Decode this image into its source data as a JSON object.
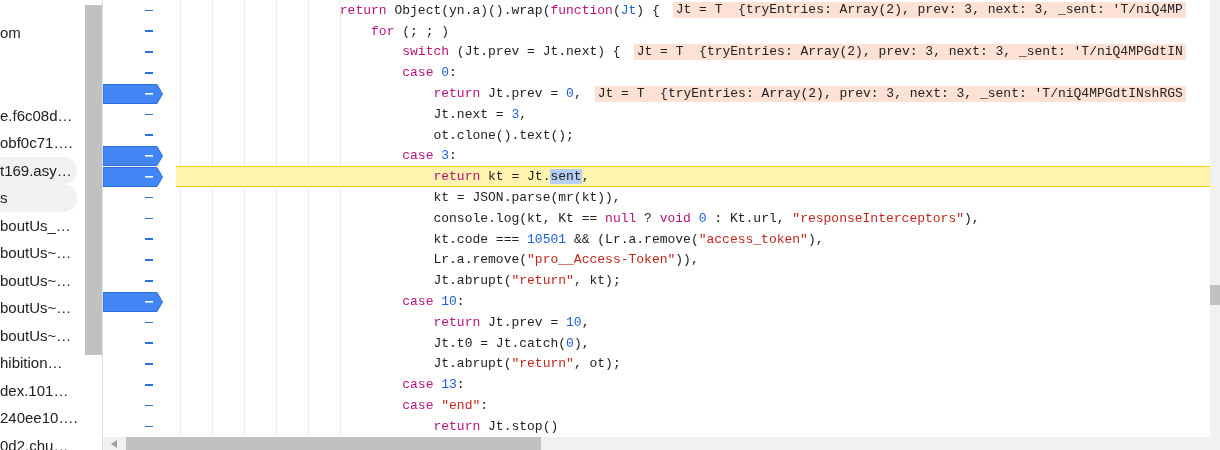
{
  "sidebar": {
    "items": [
      {
        "label": "om",
        "selected": false
      },
      {
        "label": "e.f6c08d…",
        "selected": false
      },
      {
        "label": "obf0c71….",
        "selected": false
      },
      {
        "label": "t169.asy…",
        "selected": true
      },
      {
        "label": "s",
        "selected": true
      },
      {
        "label": "boutUs_…",
        "selected": false
      },
      {
        "label": "boutUs~…",
        "selected": false
      },
      {
        "label": "boutUs~…",
        "selected": false
      },
      {
        "label": "boutUs~…",
        "selected": false
      },
      {
        "label": "boutUs~…",
        "selected": false
      },
      {
        "label": "hibition…",
        "selected": false
      },
      {
        "label": "dex.101…",
        "selected": false
      },
      {
        "label": "240ee10….",
        "selected": false
      },
      {
        "label": "0d2.chu…",
        "selected": false
      }
    ]
  },
  "code": [
    {
      "breakpoint": false,
      "current": false,
      "tokens": [
        {
          "text": "return ",
          "kind": "keyword"
        },
        {
          "text": "Object(yn.a)().wrap(",
          "kind": "plain"
        },
        {
          "text": "function",
          "kind": "keyword"
        },
        {
          "text": "(",
          "kind": "plain"
        },
        {
          "text": "Jt",
          "kind": "param"
        },
        {
          "text": ") {",
          "kind": "plain"
        }
      ],
      "inline_value": "Jt = T  {tryEntries: Array(2), prev: 3, next: 3, _sent: 'T/niQ4MP",
      "children": [
        {
          "breakpoint": false,
          "current": false,
          "tokens": [
            {
              "text": "for",
              "kind": "keyword"
            },
            {
              "text": " (; ; )",
              "kind": "plain"
            }
          ],
          "children": [
            {
              "breakpoint": false,
              "current": false,
              "tokens": [
                {
                  "text": "switch",
                  "kind": "keyword"
                },
                {
                  "text": " (Jt.prev = Jt.next) {",
                  "kind": "plain"
                }
              ],
              "inline_value": "Jt = T  {tryEntries: Array(2), prev: 3, next: 3, _sent: 'T/niQ4MPGdtIN"
            },
            {
              "breakpoint": false,
              "current": false,
              "tokens": [
                {
                  "text": "case ",
                  "kind": "keyword"
                },
                {
                  "text": "0",
                  "kind": "number"
                },
                {
                  "text": ":",
                  "kind": "plain"
                }
              ],
              "children": [
                {
                  "breakpoint": true,
                  "current": false,
                  "tokens": [
                    {
                      "text": "return ",
                      "kind": "keyword"
                    },
                    {
                      "text": "Jt.prev = ",
                      "kind": "plain"
                    },
                    {
                      "text": "0",
                      "kind": "number"
                    },
                    {
                      "text": ",",
                      "kind": "plain"
                    }
                  ],
                  "inline_value": "Jt = T  {tryEntries: Array(2), prev: 3, next: 3, _sent: 'T/niQ4MPGdtINshRGS"
                },
                {
                  "breakpoint": false,
                  "current": false,
                  "tokens": [
                    {
                      "text": "Jt.next = ",
                      "kind": "plain"
                    },
                    {
                      "text": "3",
                      "kind": "number"
                    },
                    {
                      "text": ",",
                      "kind": "plain"
                    }
                  ]
                },
                {
                  "breakpoint": false,
                  "current": false,
                  "tokens": [
                    {
                      "text": "ot.clone().text();",
                      "kind": "plain"
                    }
                  ]
                }
              ]
            },
            {
              "breakpoint": true,
              "current": false,
              "tokens": [
                {
                  "text": "case ",
                  "kind": "keyword"
                },
                {
                  "text": "3",
                  "kind": "number"
                },
                {
                  "text": ":",
                  "kind": "plain"
                }
              ],
              "children": [
                {
                  "breakpoint": true,
                  "current": true,
                  "tokens": [
                    {
                      "text": "return ",
                      "kind": "keyword"
                    },
                    {
                      "text": "kt = Jt.",
                      "kind": "plain"
                    },
                    {
                      "text": "sent",
                      "kind": "selection"
                    },
                    {
                      "text": ",",
                      "kind": "plain"
                    }
                  ]
                },
                {
                  "breakpoint": false,
                  "current": false,
                  "tokens": [
                    {
                      "text": "kt = JSON.parse(mr(kt)),",
                      "kind": "plain"
                    }
                  ]
                },
                {
                  "breakpoint": false,
                  "current": false,
                  "tokens": [
                    {
                      "text": "console.log(kt, Kt == ",
                      "kind": "plain"
                    },
                    {
                      "text": "null",
                      "kind": "keyword"
                    },
                    {
                      "text": " ? ",
                      "kind": "plain"
                    },
                    {
                      "text": "void ",
                      "kind": "keyword"
                    },
                    {
                      "text": "0",
                      "kind": "number"
                    },
                    {
                      "text": " : Kt.url, ",
                      "kind": "plain"
                    },
                    {
                      "text": "\"responseInterceptors\"",
                      "kind": "string"
                    },
                    {
                      "text": "),",
                      "kind": "plain"
                    }
                  ]
                },
                {
                  "breakpoint": false,
                  "current": false,
                  "tokens": [
                    {
                      "text": "kt.code === ",
                      "kind": "plain"
                    },
                    {
                      "text": "10501",
                      "kind": "number"
                    },
                    {
                      "text": " && (Lr.a.remove(",
                      "kind": "plain"
                    },
                    {
                      "text": "\"access_token\"",
                      "kind": "string"
                    },
                    {
                      "text": "),",
                      "kind": "plain"
                    }
                  ]
                },
                {
                  "breakpoint": false,
                  "current": false,
                  "tokens": [
                    {
                      "text": "Lr.a.remove(",
                      "kind": "plain"
                    },
                    {
                      "text": "\"pro__Access-Token\"",
                      "kind": "string"
                    },
                    {
                      "text": ")),",
                      "kind": "plain"
                    }
                  ]
                },
                {
                  "breakpoint": false,
                  "current": false,
                  "tokens": [
                    {
                      "text": "Jt.abrupt(",
                      "kind": "plain"
                    },
                    {
                      "text": "\"return\"",
                      "kind": "string"
                    },
                    {
                      "text": ", kt);",
                      "kind": "plain"
                    }
                  ]
                }
              ]
            },
            {
              "breakpoint": true,
              "current": false,
              "tokens": [
                {
                  "text": "case ",
                  "kind": "keyword"
                },
                {
                  "text": "10",
                  "kind": "number"
                },
                {
                  "text": ":",
                  "kind": "plain"
                }
              ],
              "children": [
                {
                  "breakpoint": false,
                  "current": false,
                  "tokens": [
                    {
                      "text": "return ",
                      "kind": "keyword"
                    },
                    {
                      "text": "Jt.prev = ",
                      "kind": "plain"
                    },
                    {
                      "text": "10",
                      "kind": "number"
                    },
                    {
                      "text": ",",
                      "kind": "plain"
                    }
                  ]
                },
                {
                  "breakpoint": false,
                  "current": false,
                  "tokens": [
                    {
                      "text": "Jt.t0 = Jt.catch(",
                      "kind": "plain"
                    },
                    {
                      "text": "0",
                      "kind": "number"
                    },
                    {
                      "text": "),",
                      "kind": "plain"
                    }
                  ]
                },
                {
                  "breakpoint": false,
                  "current": false,
                  "tokens": [
                    {
                      "text": "Jt.abrupt(",
                      "kind": "plain"
                    },
                    {
                      "text": "\"return\"",
                      "kind": "string"
                    },
                    {
                      "text": ", ot);",
                      "kind": "plain"
                    }
                  ]
                }
              ]
            },
            {
              "breakpoint": false,
              "current": false,
              "tokens": [
                {
                  "text": "case ",
                  "kind": "keyword"
                },
                {
                  "text": "13",
                  "kind": "number"
                },
                {
                  "text": ":",
                  "kind": "plain"
                }
              ]
            },
            {
              "breakpoint": false,
              "current": false,
              "tokens": [
                {
                  "text": "case ",
                  "kind": "keyword"
                },
                {
                  "text": "\"end\"",
                  "kind": "string"
                },
                {
                  "text": ":",
                  "kind": "plain"
                }
              ],
              "children": [
                {
                  "breakpoint": false,
                  "current": false,
                  "tokens": [
                    {
                      "text": "return ",
                      "kind": "keyword"
                    },
                    {
                      "text": "Jt.stop()",
                      "kind": "plain"
                    }
                  ]
                }
              ]
            }
          ]
        }
      ]
    }
  ]
}
